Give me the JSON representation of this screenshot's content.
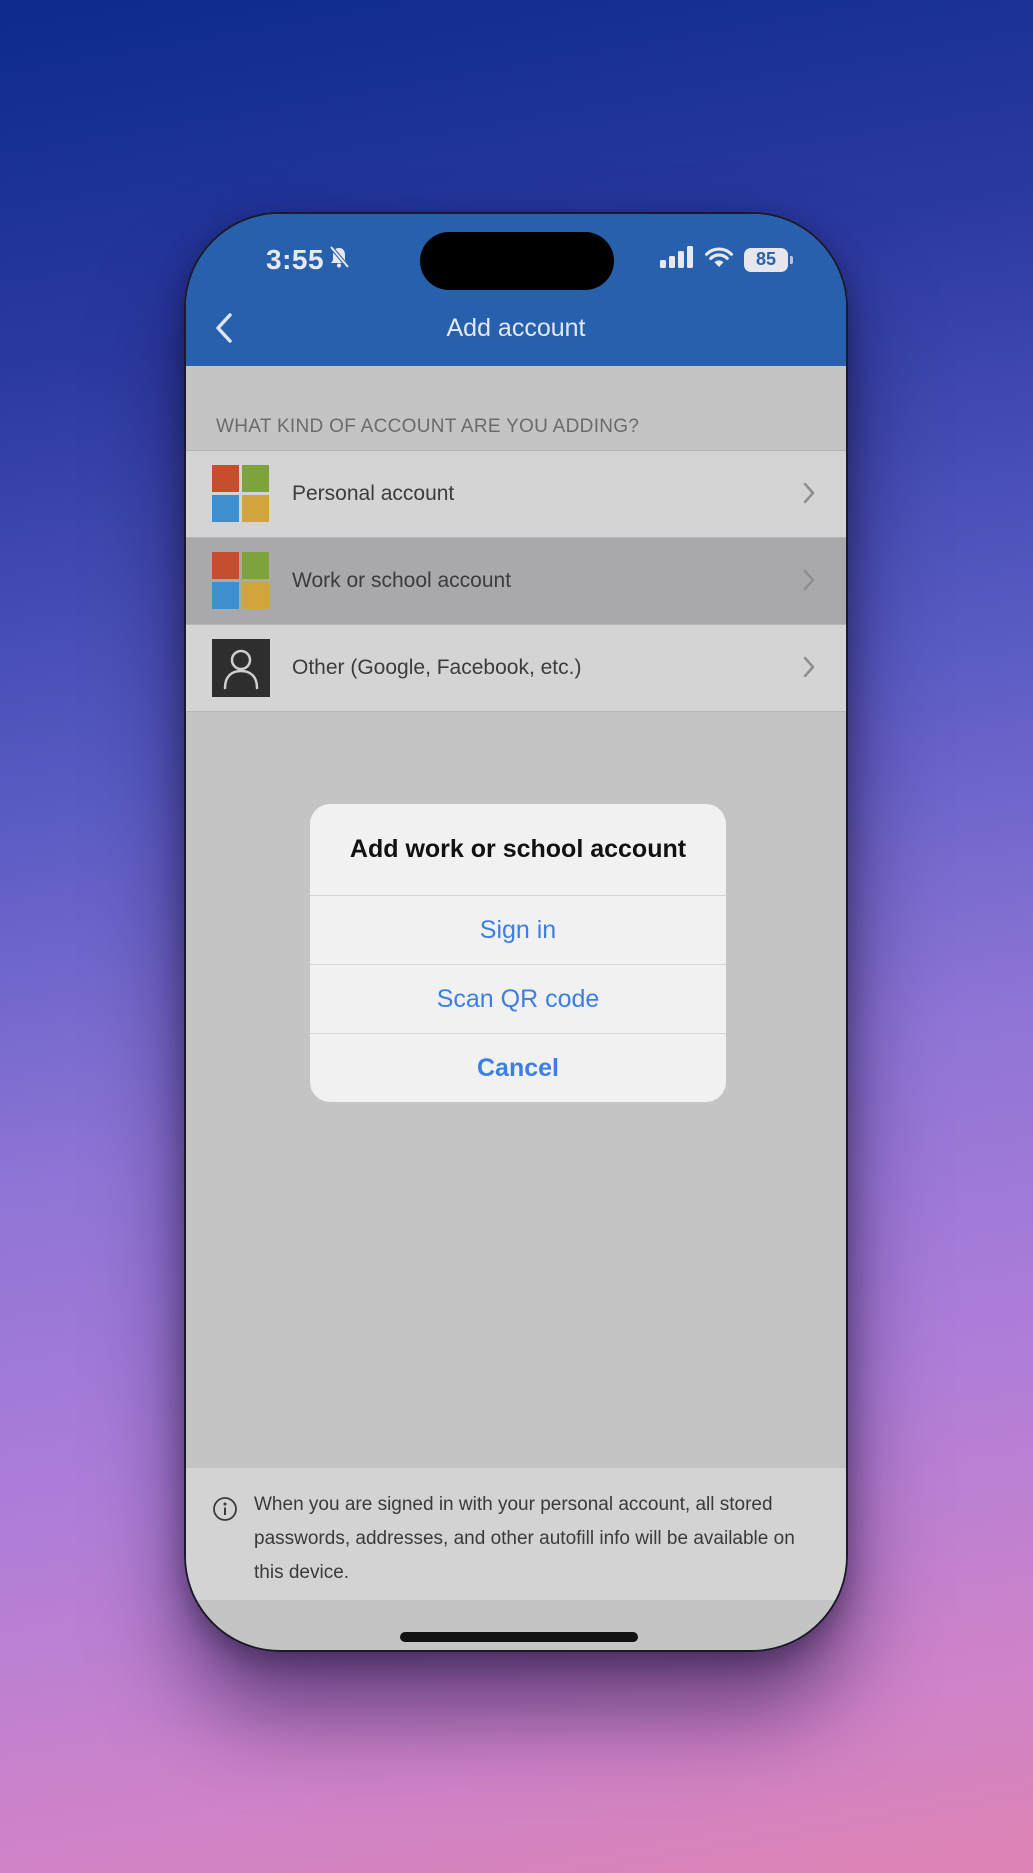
{
  "status_bar": {
    "time": "3:55",
    "battery": "85",
    "icons": [
      "bell-slash-icon",
      "cellular-signal-icon",
      "wifi-icon",
      "battery-icon"
    ]
  },
  "nav": {
    "title": "Add account",
    "back_icon": "chevron-left-icon"
  },
  "section": {
    "header": "WHAT KIND OF ACCOUNT ARE YOU ADDING?"
  },
  "accounts": [
    {
      "label": "Personal account",
      "icon": "microsoft-logo-icon"
    },
    {
      "label": "Work or school account",
      "icon": "microsoft-logo-icon",
      "selected": true
    },
    {
      "label": "Other (Google, Facebook, etc.)",
      "icon": "person-icon"
    }
  ],
  "dialog": {
    "title": "Add work or school account",
    "buttons": [
      "Sign in",
      "Scan QR code",
      "Cancel"
    ]
  },
  "footer": {
    "text": "When you are signed in with your personal account, all stored passwords, addresses, and other autofill info will be available on this device."
  },
  "colors": {
    "header": "#2761ad",
    "accent": "#3b7fe4",
    "dimmed_background": "#c4c4c4"
  }
}
